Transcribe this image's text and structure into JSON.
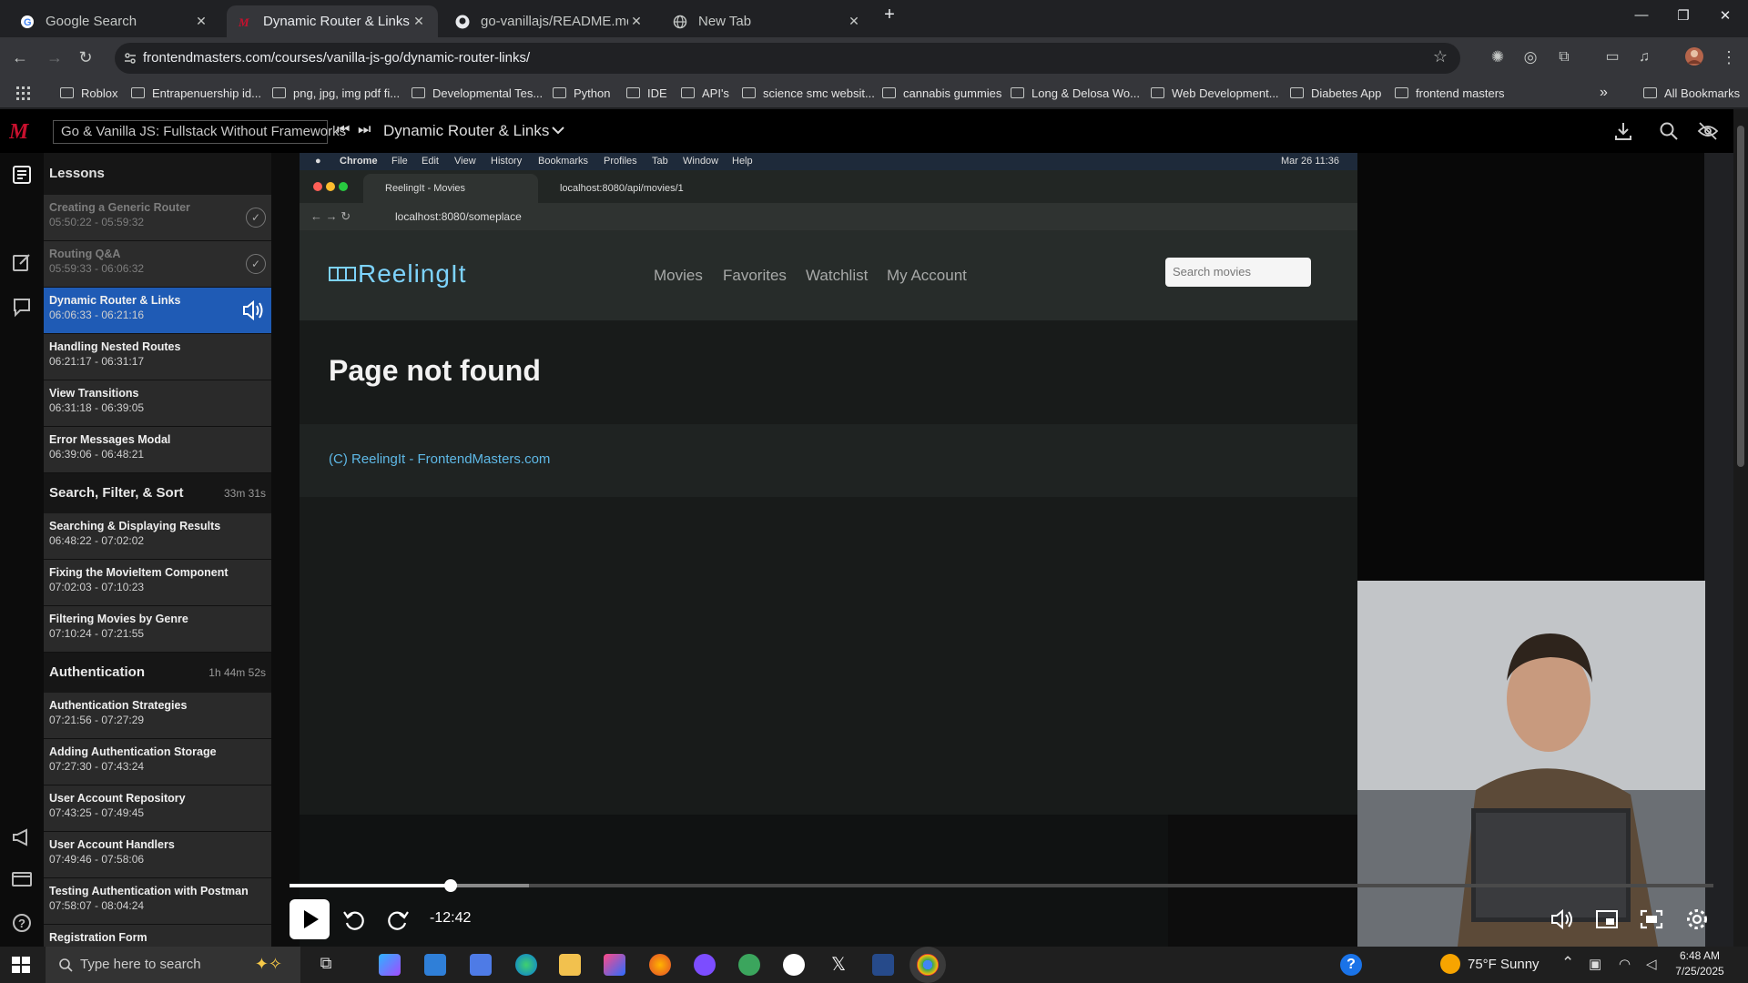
{
  "browser": {
    "tabs": [
      {
        "title": "Google Search",
        "active": false
      },
      {
        "title": "Dynamic Router & Links - Go &",
        "active": true
      },
      {
        "title": "go-vanillajs/README.md at ma",
        "active": false
      },
      {
        "title": "New Tab",
        "active": false
      }
    ],
    "url": "frontendmasters.com/courses/vanilla-js-go/dynamic-router-links/",
    "bookmarks": [
      "Roblox",
      "Entrapenuership id...",
      "png, jpg, img pdf fi...",
      "Developmental Tes...",
      "Python",
      "IDE",
      "API's",
      "science smc websit...",
      "cannabis gummies",
      "Long & Delosa Wo...",
      "Web Development...",
      "Diabetes App",
      "frontend masters"
    ],
    "all_bookmarks": "All Bookmarks"
  },
  "player_header": {
    "course": "Go & Vanilla JS: Fullstack Without Frameworks",
    "lesson": "Dynamic Router & Links"
  },
  "sidebar": {
    "title": "Lessons",
    "items": [
      {
        "kind": "lesson",
        "title": "Creating a Generic Router",
        "time": "05:50:22 - 05:59:32",
        "state": "done"
      },
      {
        "kind": "lesson",
        "title": "Routing Q&A",
        "time": "05:59:33 - 06:06:32",
        "state": "done"
      },
      {
        "kind": "lesson",
        "title": "Dynamic Router & Links",
        "time": "06:06:33 - 06:21:16",
        "state": "current"
      },
      {
        "kind": "lesson",
        "title": "Handling Nested Routes",
        "time": "06:21:17 - 06:31:17",
        "state": ""
      },
      {
        "kind": "lesson",
        "title": "View Transitions",
        "time": "06:31:18 - 06:39:05",
        "state": ""
      },
      {
        "kind": "lesson",
        "title": "Error Messages Modal",
        "time": "06:39:06 - 06:48:21",
        "state": ""
      },
      {
        "kind": "section",
        "title": "Search, Filter, & Sort",
        "duration": "33m 31s"
      },
      {
        "kind": "lesson",
        "title": "Searching & Displaying Results",
        "time": "06:48:22 - 07:02:02",
        "state": ""
      },
      {
        "kind": "lesson",
        "title": "Fixing the MovieItem Component",
        "time": "07:02:03 - 07:10:23",
        "state": ""
      },
      {
        "kind": "lesson",
        "title": "Filtering Movies by Genre",
        "time": "07:10:24 - 07:21:55",
        "state": ""
      },
      {
        "kind": "section",
        "title": "Authentication",
        "duration": "1h 44m 52s"
      },
      {
        "kind": "lesson",
        "title": "Authentication Strategies",
        "time": "07:21:56 - 07:27:29",
        "state": ""
      },
      {
        "kind": "lesson",
        "title": "Adding Authentication Storage",
        "time": "07:27:30 - 07:43:24",
        "state": ""
      },
      {
        "kind": "lesson",
        "title": "User Account Repository",
        "time": "07:43:25 - 07:49:45",
        "state": ""
      },
      {
        "kind": "lesson",
        "title": "User Account Handlers",
        "time": "07:49:46 - 07:58:06",
        "state": ""
      },
      {
        "kind": "lesson",
        "title": "Testing Authentication with Postman",
        "time": "07:58:07 - 08:04:24",
        "state": ""
      },
      {
        "kind": "lesson",
        "title": "Registration Form",
        "time": "",
        "state": ""
      }
    ]
  },
  "video": {
    "mac_menu": [
      "Chrome",
      "File",
      "Edit",
      "View",
      "History",
      "Bookmarks",
      "Profiles",
      "Tab",
      "Window",
      "Help"
    ],
    "mac_clock": "Mar 26  11:36",
    "inner_tabs": [
      "ReelingIt - Movies",
      "localhost:8080/api/movies/1"
    ],
    "inner_url": "localhost:8080/someplace",
    "site_logo": "ReelingIt",
    "site_nav": [
      "Movies",
      "Favorites",
      "Watchlist",
      "My Account"
    ],
    "site_search_placeholder": "Search movies",
    "site_heading": "Page not found",
    "site_footer": "(C) ReelingIt - FrontendMasters.com",
    "remaining": "-12:42",
    "progress_fraction": 0.113,
    "buffered_fraction": 0.168
  },
  "taskbar": {
    "search_placeholder": "Type here to search",
    "weather": "75°F  Sunny",
    "time": "6:48 AM",
    "date": "7/25/2025"
  },
  "colors": {
    "accent": "#1f5bb5",
    "fm_red": "#c8102e",
    "site_accent": "#5eb8e6"
  }
}
